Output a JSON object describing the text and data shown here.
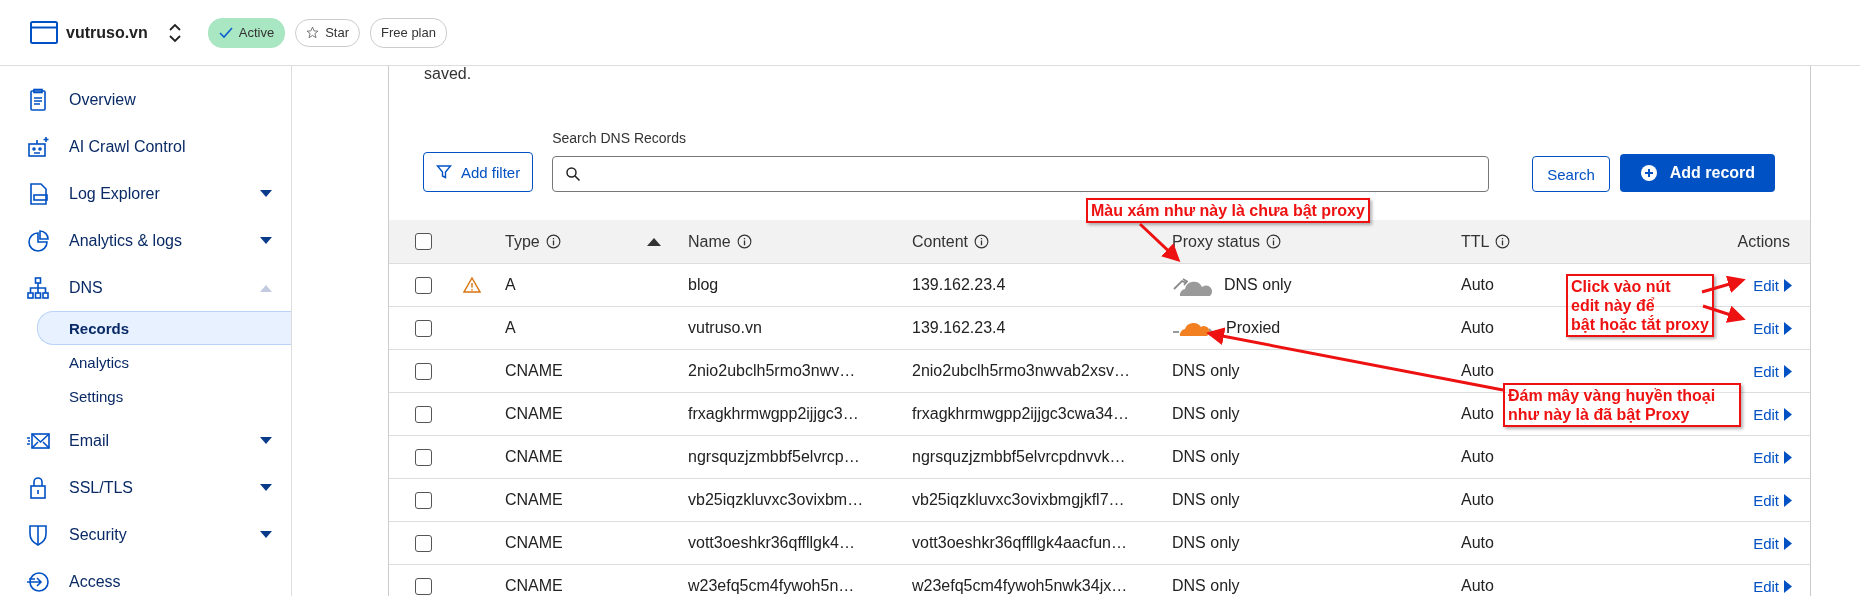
{
  "topbar": {
    "site": "vutruso.vn",
    "status": "Active",
    "star": "Star",
    "plan": "Free plan"
  },
  "sidebar": {
    "items": [
      {
        "label": "Overview"
      },
      {
        "label": "AI Crawl Control"
      },
      {
        "label": "Log Explorer",
        "expanded": false
      },
      {
        "label": "Analytics & logs",
        "expanded": false
      },
      {
        "label": "DNS",
        "expanded": true,
        "children": [
          {
            "label": "Records",
            "selected": true
          },
          {
            "label": "Analytics",
            "selected": false
          },
          {
            "label": "Settings",
            "selected": false
          }
        ]
      },
      {
        "label": "Email",
        "expanded": false
      },
      {
        "label": "SSL/TLS",
        "expanded": false
      },
      {
        "label": "Security",
        "expanded": false
      },
      {
        "label": "Access"
      }
    ]
  },
  "card": {
    "intro": "saved.",
    "search_label": "Search DNS Records",
    "add_filter": "Add filter",
    "search_button": "Search",
    "add_record": "Add record"
  },
  "table": {
    "select_all": {
      "checked": false
    },
    "columns": [
      {
        "label": "Type",
        "info": true,
        "sorted": true
      },
      {
        "label": "Name",
        "info": true
      },
      {
        "label": "Content",
        "info": true
      },
      {
        "label": "Proxy status",
        "info": true
      },
      {
        "label": "TTL",
        "info": true
      },
      {
        "label": "Actions",
        "info": false
      }
    ],
    "rows": [
      {
        "checked": false,
        "warning": true,
        "type": "A",
        "name": "blog",
        "content": "139.162.23.4",
        "proxy": "DNS only",
        "proxied": false,
        "ttl": "Auto",
        "action": "Edit"
      },
      {
        "checked": false,
        "warning": false,
        "type": "A",
        "name": "vutruso.vn",
        "content": "139.162.23.4",
        "proxy": "Proxied",
        "proxied": true,
        "ttl": "Auto",
        "action": "Edit"
      },
      {
        "checked": false,
        "warning": false,
        "type": "CNAME",
        "name": "2nio2ubclh5rmo3nwv…",
        "content": "2nio2ubclh5rmo3nwvab2xsv…",
        "proxy": "DNS only",
        "ttl": "Auto",
        "action": "Edit"
      },
      {
        "checked": false,
        "warning": false,
        "type": "CNAME",
        "name": "frxagkhrmwgpp2ijjgc3…",
        "content": "frxagkhrmwgpp2ijjgc3cwa34…",
        "proxy": "DNS only",
        "ttl": "Auto",
        "action": "Edit"
      },
      {
        "checked": false,
        "warning": false,
        "type": "CNAME",
        "name": "ngrsquzjzmbbf5elvrcp…",
        "content": "ngrsquzjzmbbf5elvrcpdnvvk…",
        "proxy": "DNS only",
        "ttl": "Auto",
        "action": "Edit"
      },
      {
        "checked": false,
        "warning": false,
        "type": "CNAME",
        "name": "vb25iqzkluvxc3ovixbm…",
        "content": "vb25iqzkluvxc3ovixbmgjkfl7…",
        "proxy": "DNS only",
        "ttl": "Auto",
        "action": "Edit"
      },
      {
        "checked": false,
        "warning": false,
        "type": "CNAME",
        "name": "vott3oeshkr36qffllgk4…",
        "content": "vott3oeshkr36qffllgk4aacfun…",
        "proxy": "DNS only",
        "ttl": "Auto",
        "action": "Edit"
      },
      {
        "checked": false,
        "warning": false,
        "type": "CNAME",
        "name": "w23efq5cm4fywoh5n…",
        "content": "w23efq5cm4fywoh5nwk34jx…",
        "proxy": "DNS only",
        "ttl": "Auto",
        "action": "Edit"
      }
    ]
  },
  "annotations": [
    {
      "text": "Màu xám như này là chưa bật proxy"
    },
    {
      "text": "Click vào nút\nedit này để\nbật hoặc tắt proxy"
    },
    {
      "text": "Đám mây vàng huyền thoại như này là đã bật Proxy"
    }
  ]
}
